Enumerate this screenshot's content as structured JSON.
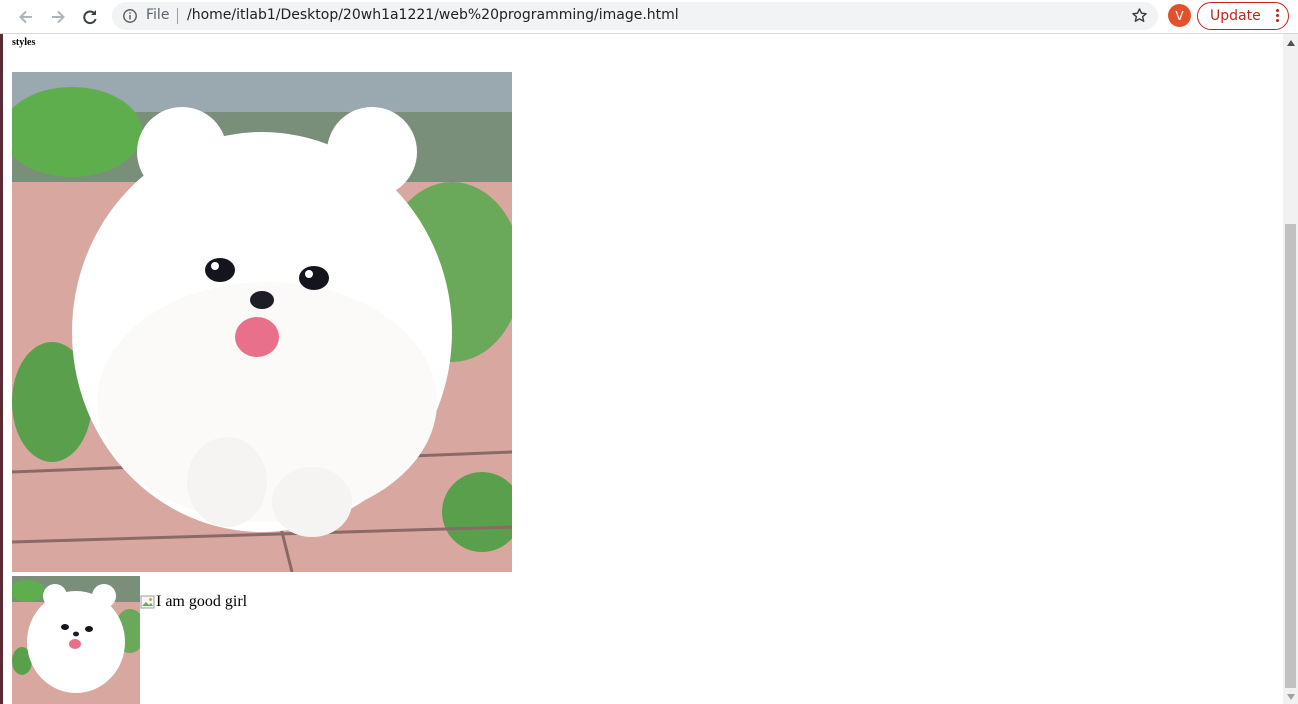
{
  "browser": {
    "url_scheme": "File",
    "url": "/home/itlab1/Desktop/20wh1a1221/web%20programming/image.html",
    "avatar_initial": "V",
    "update_label": "Update"
  },
  "page": {
    "heading": "styles",
    "broken_image_alt": "I am good girl"
  },
  "colors": {
    "accent_update": "#c5221f",
    "avatar_bg": "#e0522d"
  }
}
